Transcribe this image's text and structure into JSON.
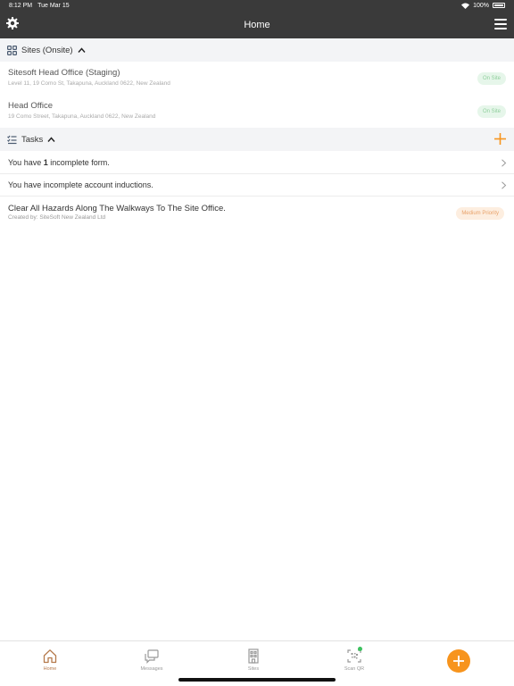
{
  "status": {
    "time": "8:12 PM",
    "date": "Tue Mar 15",
    "battery": "100%"
  },
  "nav": {
    "title": "Home"
  },
  "sites_section": {
    "title": "Sites (Onsite)"
  },
  "sites": [
    {
      "name": "Sitesoft Head Office (Staging)",
      "address": "Level 11, 19 Como St, Takapuna, Auckland 0622, New Zealand",
      "badge": "On Site"
    },
    {
      "name": "Head Office",
      "address": "19 Como Street, Takapuna, Auckland 0622, New Zealand",
      "badge": "On Site"
    }
  ],
  "tasks_section": {
    "title": "Tasks"
  },
  "task_rows": {
    "forms_prefix": "You have ",
    "forms_count": "1",
    "forms_suffix": " incomplete form.",
    "inductions": "You have incomplete account inductions."
  },
  "task": {
    "title": "Clear All Hazards Along The Walkways To The Site Office.",
    "created_by": "Created by: SiteSoft New Zealand Ltd",
    "priority": "Medium Priority"
  },
  "tabs": [
    {
      "label": "Home",
      "icon": "home-icon",
      "active": true
    },
    {
      "label": "Messages",
      "icon": "messages-icon",
      "active": false
    },
    {
      "label": "Sites",
      "icon": "building-icon",
      "active": false
    },
    {
      "label": "Scan QR",
      "icon": "qr-icon",
      "active": false
    }
  ],
  "colors": {
    "header": "#3a3a3a",
    "accent": "#f7941d",
    "onsite_bg": "#e6f6ea",
    "onsite_text": "#8fcf9c",
    "priority_bg": "#fdeee0",
    "priority_text": "#e8a26a",
    "active_tab": "#b57a4c"
  }
}
